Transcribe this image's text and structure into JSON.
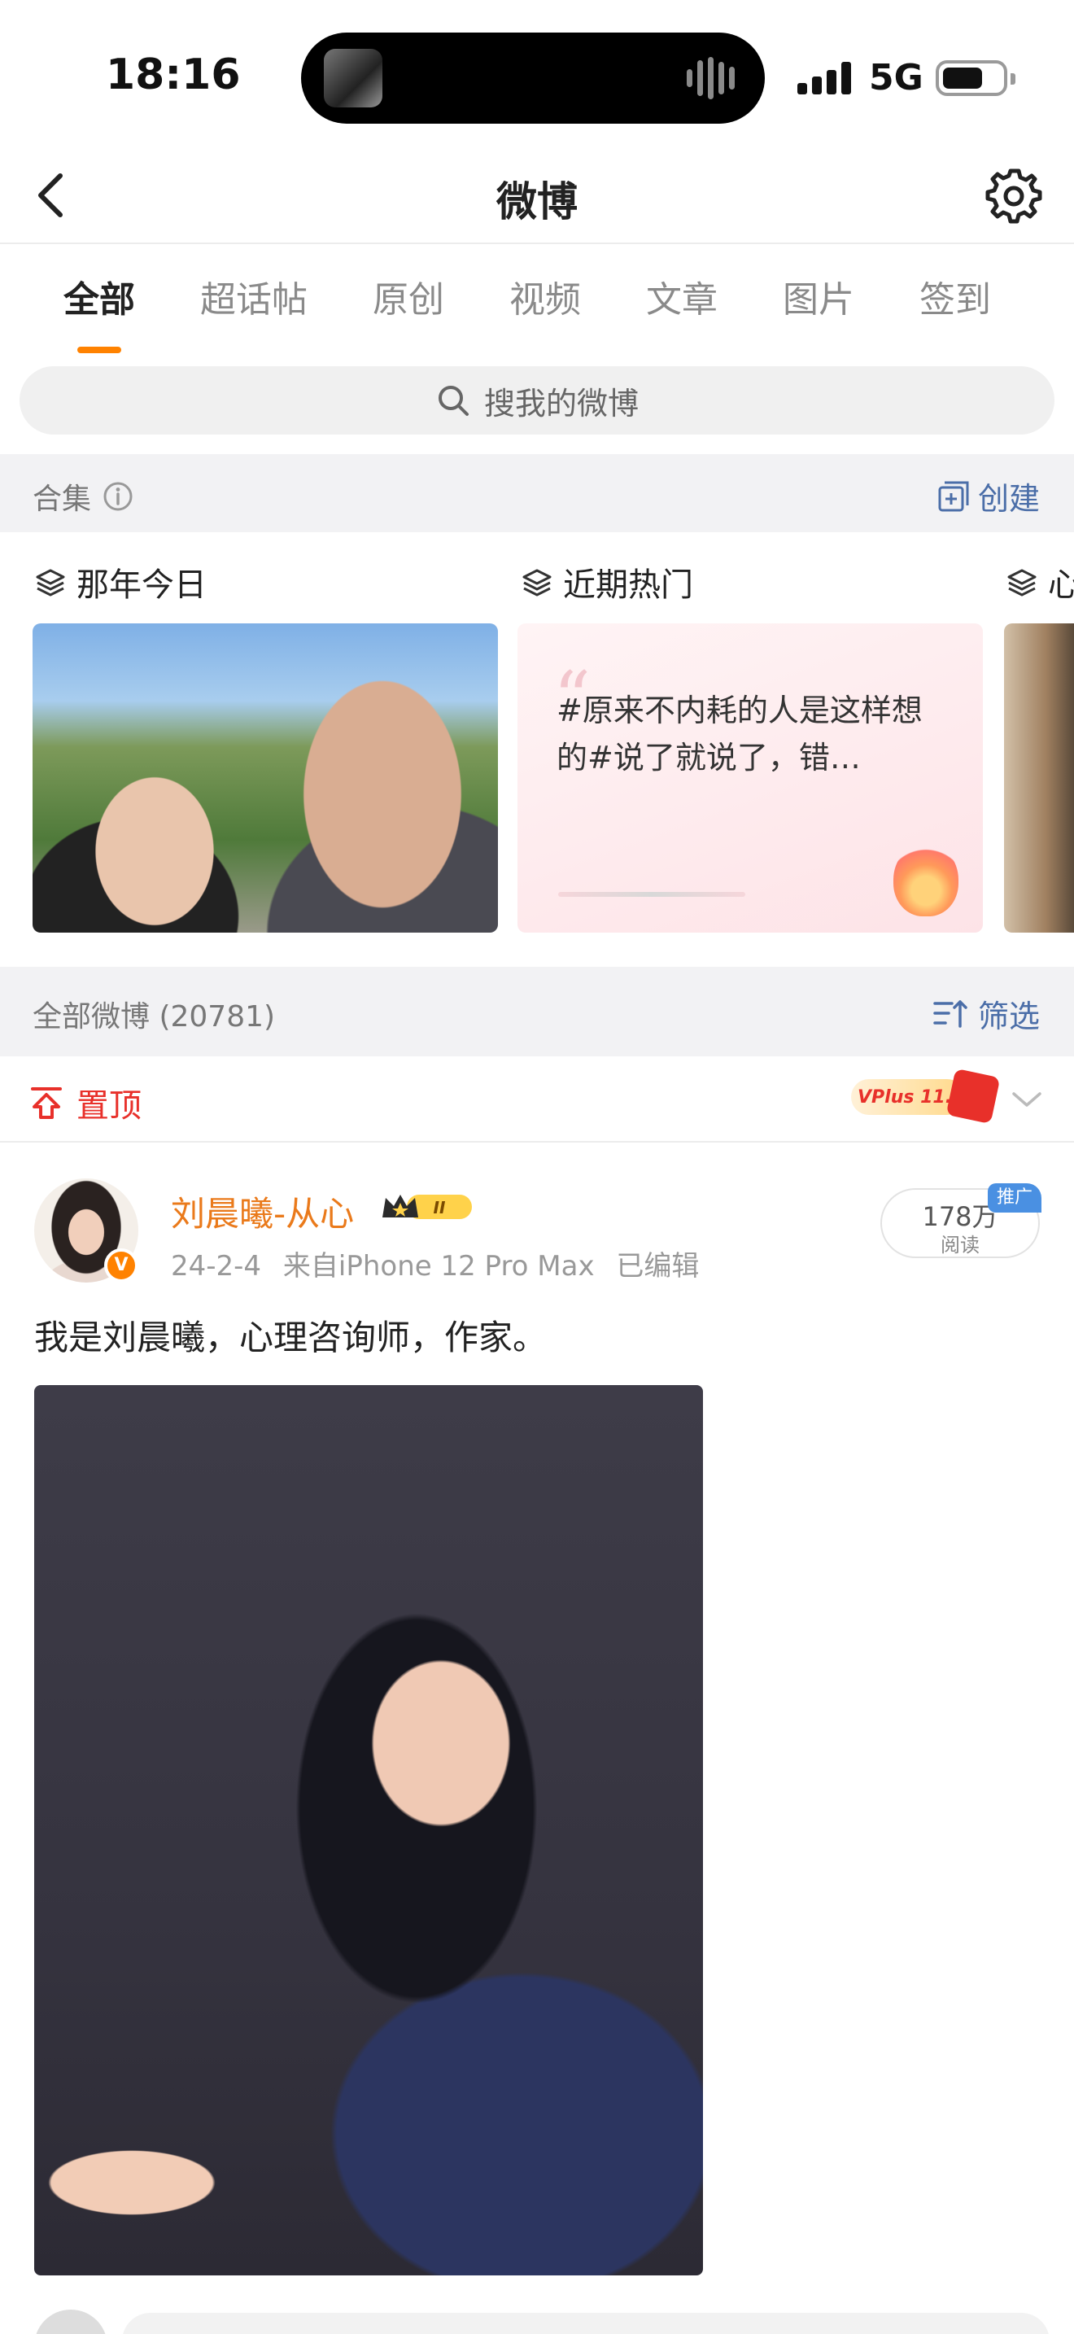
{
  "status_bar": {
    "time": "18:16",
    "network": "5G"
  },
  "nav": {
    "title": "微博"
  },
  "tabs": [
    {
      "label": "全部",
      "active": true
    },
    {
      "label": "超话帖",
      "active": false
    },
    {
      "label": "原创",
      "active": false
    },
    {
      "label": "视频",
      "active": false
    },
    {
      "label": "文章",
      "active": false
    },
    {
      "label": "图片",
      "active": false
    },
    {
      "label": "签到",
      "active": false
    }
  ],
  "search": {
    "placeholder": "搜我的微博"
  },
  "collections": {
    "header": "合集",
    "create_label": "创建",
    "items": [
      {
        "title": "那年今日"
      },
      {
        "title": "近期热门",
        "quote": "#原来不内耗的人是这样想的#说了就说了，错…"
      },
      {
        "title": "心"
      }
    ]
  },
  "feed": {
    "header": "全部微博 (20781)",
    "filter_label": "筛选",
    "pinned_label": "置顶",
    "vplus_text": "VPlus 11.11"
  },
  "post": {
    "author": "刘晨曦-从心",
    "level": "II",
    "date": "24-2-4",
    "source": "来自iPhone 12 Pro Max",
    "edited": "已编辑",
    "reads": "178万",
    "reads_unit": "阅读",
    "promo_badge": "推广",
    "text": "我是刘晨曦，心理咨询师，作家。"
  },
  "colors": {
    "accent": "#ff8200",
    "author": "#ea7a1b",
    "pinned": "#e8302a",
    "link": "#4b6ea8"
  }
}
